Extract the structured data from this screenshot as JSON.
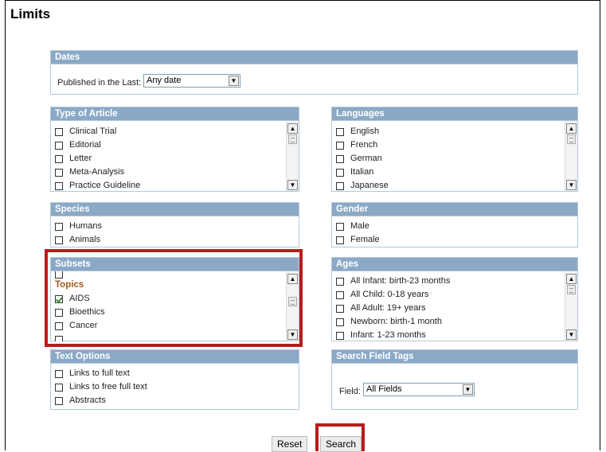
{
  "page_title": "Limits",
  "dates": {
    "header": "Dates",
    "label": "Published in the Last:",
    "value": "Any date"
  },
  "type_of_article": {
    "header": "Type of Article",
    "items": [
      {
        "label": "Clinical Trial",
        "checked": false
      },
      {
        "label": "Editorial",
        "checked": false
      },
      {
        "label": "Letter",
        "checked": false
      },
      {
        "label": "Meta-Analysis",
        "checked": false
      },
      {
        "label": "Practice Guideline",
        "checked": false
      }
    ]
  },
  "languages": {
    "header": "Languages",
    "items": [
      {
        "label": "English",
        "checked": false
      },
      {
        "label": "French",
        "checked": false
      },
      {
        "label": "German",
        "checked": false
      },
      {
        "label": "Italian",
        "checked": false
      },
      {
        "label": "Japanese",
        "checked": false
      }
    ]
  },
  "species": {
    "header": "Species",
    "items": [
      {
        "label": "Humans",
        "checked": false
      },
      {
        "label": "Animals",
        "checked": false
      }
    ]
  },
  "gender": {
    "header": "Gender",
    "items": [
      {
        "label": "Male",
        "checked": false
      },
      {
        "label": "Female",
        "checked": false
      }
    ]
  },
  "subsets": {
    "header": "Subsets",
    "topics_heading": "Topics",
    "items": [
      {
        "label": "AIDS",
        "checked": true
      },
      {
        "label": "Bioethics",
        "checked": false
      },
      {
        "label": "Cancer",
        "checked": false
      }
    ]
  },
  "ages": {
    "header": "Ages",
    "items": [
      {
        "label": "All Infant: birth-23 months",
        "checked": false
      },
      {
        "label": "All Child: 0-18 years",
        "checked": false
      },
      {
        "label": "All Adult: 19+ years",
        "checked": false
      },
      {
        "label": "Newborn: birth-1 month",
        "checked": false
      },
      {
        "label": "Infant: 1-23 months",
        "checked": false
      }
    ]
  },
  "text_options": {
    "header": "Text Options",
    "items": [
      {
        "label": "Links to full text",
        "checked": false
      },
      {
        "label": "Links to free full text",
        "checked": false
      },
      {
        "label": "Abstracts",
        "checked": false
      }
    ]
  },
  "search_field_tags": {
    "header": "Search Field Tags",
    "label": "Field:",
    "value": "All Fields"
  },
  "buttons": {
    "reset": "Reset",
    "search": "Search"
  },
  "icons": {
    "scroll_up": "scroll-up-arrow-icon",
    "scroll_down": "scroll-down-arrow-icon",
    "dropdown": "chevron-down-icon"
  },
  "colors": {
    "panel_header": "#8aa9c7",
    "highlight": "#b81c1c",
    "topics": "#a05a1f"
  }
}
